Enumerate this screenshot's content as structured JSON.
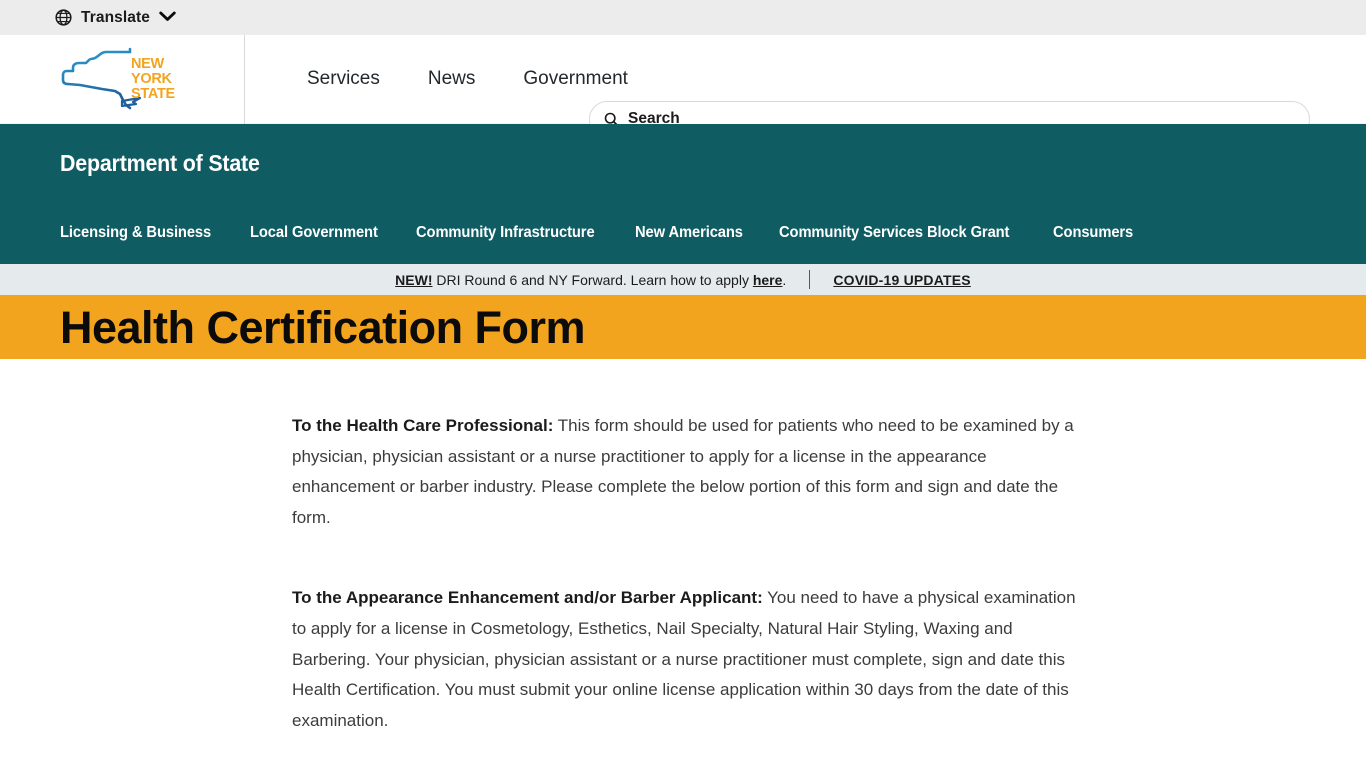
{
  "utility_bar": {
    "translate_label": "Translate",
    "globe_icon": "globe-icon",
    "chevron_icon": "chevron-down-icon",
    "background": "#ececec"
  },
  "masthead": {
    "logo": {
      "name": "new-york-state-logo",
      "line1": "NEW",
      "line2": "YORK",
      "line3": "STATE",
      "text_color": "#f3a41f",
      "outline_top_color": "#2e9fd4",
      "outline_bottom_color": "#1f5f9e"
    },
    "nav": [
      {
        "label": "Services"
      },
      {
        "label": "News"
      },
      {
        "label": "Government"
      }
    ],
    "search": {
      "placeholder": "Search",
      "value": "",
      "icon": "search-icon"
    }
  },
  "agency": {
    "title": "Department of State",
    "background": "#0f5c63",
    "nav": [
      {
        "label": "Licensing & Business"
      },
      {
        "label": "Local Government"
      },
      {
        "label": "Community Infrastructure"
      },
      {
        "label": "New Americans"
      },
      {
        "label": "Community Services Block Grant"
      },
      {
        "label": "Consumers"
      }
    ]
  },
  "alert_bar": {
    "background": "#e5eaec",
    "new_badge": "NEW!",
    "message_before_link": " DRI Round 6 and NY Forward. Learn how to apply ",
    "link_text": "here",
    "message_after_link": ".",
    "covid_link": "COVID-19 UPDATES"
  },
  "page_title": {
    "text": "Health Certification Form",
    "background": "#f3a41f",
    "color": "#0b0b0b"
  },
  "body": {
    "paragraphs": [
      {
        "lead": "To the Health Care Professional:",
        "text": " This form should be used for patients who need to be examined by a physician, physician assistant or a nurse practitioner to apply for a license in the appearance enhancement or barber industry. Please complete the below portion of this form and sign and date the form."
      },
      {
        "lead": "To the Appearance Enhancement and/or Barber Applicant:",
        "text": " You need to have a physical examination to apply for a license in Cosmetology, Esthetics, Nail Specialty, Natural Hair Styling, Waxing and Barbering. Your physician, physician assistant or a nurse practitioner must complete, sign and date this Health Certification. You must submit your online license application within 30 days from the date of this examination."
      }
    ]
  }
}
